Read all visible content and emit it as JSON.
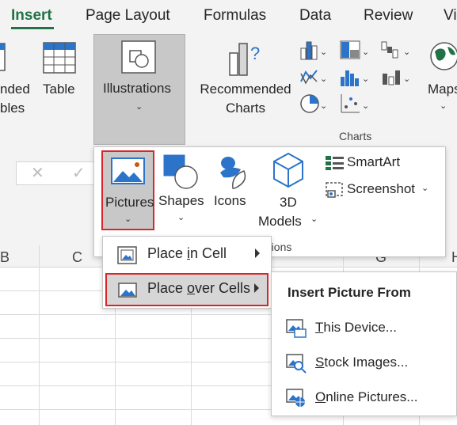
{
  "tabs": {
    "insert": "Insert",
    "page_layout": "Page Layout",
    "formulas": "Formulas",
    "data": "Data",
    "review": "Review",
    "view_partial": "Vi"
  },
  "ribbon": {
    "pivot_partial_line1": "nded",
    "pivot_partial_line2": "bles",
    "table": "Table",
    "illustrations": "Illustrations",
    "recommended_line1": "Recommended",
    "recommended_line2": "Charts",
    "maps_partial": "Maps",
    "charts_group": "Charts"
  },
  "illustrations_menu": {
    "pictures": "Pictures",
    "shapes": "Shapes",
    "icons": "Icons",
    "models_line1": "3D",
    "models_line2": "Models",
    "smartart": "SmartArt",
    "screenshot": "Screenshot",
    "group_partial": "ations"
  },
  "pictures_submenu": {
    "place_in_cell_pre": "Place ",
    "place_in_cell_u": "i",
    "place_in_cell_post": "n Cell",
    "place_over_pre": "Place ",
    "place_over_u": "o",
    "place_over_post": "ver Cells"
  },
  "insert_picture_from": {
    "title": "Insert Picture From",
    "this_device_u": "T",
    "this_device_rest": "his Device...",
    "stock_u": "S",
    "stock_rest": "tock Images...",
    "online_u": "O",
    "online_rest": "nline Pictures..."
  },
  "columns": {
    "b": "B",
    "c": "C",
    "g": "G",
    "h": "H"
  },
  "colors": {
    "accent": "#217346",
    "highlight_border": "#d9262c",
    "ribbon_bg": "#f3f3f3",
    "selected_bg": "#c8c8c8",
    "icon_blue": "#2b74c9"
  }
}
